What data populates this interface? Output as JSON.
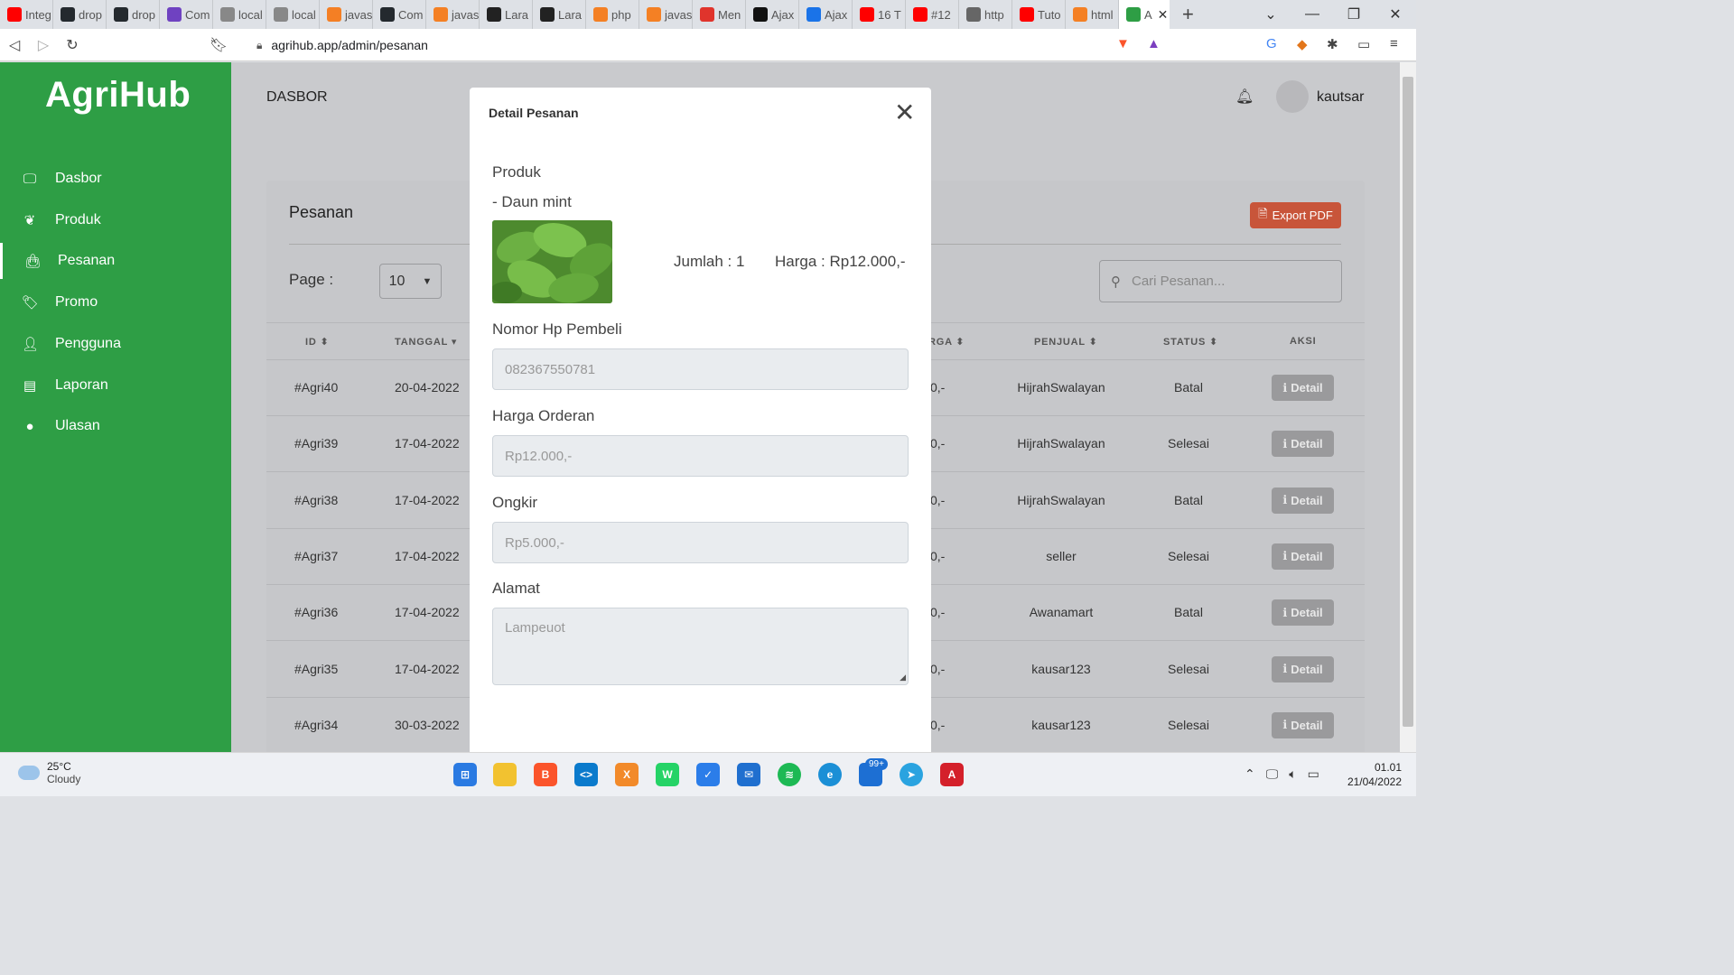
{
  "browser": {
    "tabs": [
      {
        "label": "Integ",
        "icon": "youtube-icon",
        "color": "#ff0000"
      },
      {
        "label": "drop",
        "icon": "github-icon",
        "color": "#24292e"
      },
      {
        "label": "drop",
        "icon": "github-icon",
        "color": "#24292e"
      },
      {
        "label": "Com",
        "icon": "app-icon",
        "color": "#6f42c1"
      },
      {
        "label": "local",
        "icon": "leaf-icon",
        "color": "#888888"
      },
      {
        "label": "local",
        "icon": "chart-icon",
        "color": "#888888"
      },
      {
        "label": "javas",
        "icon": "code-icon",
        "color": "#f47f24"
      },
      {
        "label": "Com",
        "icon": "github-icon",
        "color": "#24292e"
      },
      {
        "label": "javas",
        "icon": "stackoverflow-icon",
        "color": "#f48024"
      },
      {
        "label": "Lara",
        "icon": "tm-icon",
        "color": "#222222"
      },
      {
        "label": "Lara",
        "icon": "tm-icon",
        "color": "#222222"
      },
      {
        "label": "php",
        "icon": "stackoverflow-icon",
        "color": "#f48024"
      },
      {
        "label": "javas",
        "icon": "stackoverflow-icon",
        "color": "#f48024"
      },
      {
        "label": "Men",
        "icon": "qa-icon",
        "color": "#e0342c"
      },
      {
        "label": "Ajax",
        "icon": "circle-icon",
        "color": "#111111"
      },
      {
        "label": "Ajax",
        "icon": "st-icon",
        "color": "#1a73e8"
      },
      {
        "label": "16 T",
        "icon": "youtube-icon",
        "color": "#ff0000"
      },
      {
        "label": "#12",
        "icon": "youtube-icon",
        "color": "#ff0000"
      },
      {
        "label": "http",
        "icon": "page-icon",
        "color": "#666666"
      },
      {
        "label": "Tuto",
        "icon": "youtube-icon",
        "color": "#ff0000"
      },
      {
        "label": "html",
        "icon": "stackoverflow-icon",
        "color": "#f48024"
      },
      {
        "label": "A",
        "icon": "leaf-icon",
        "color": "#2e9e45"
      }
    ],
    "url": "agrihub.app/admin/pesanan"
  },
  "sidebar": {
    "logo": "AgriHub",
    "items": [
      {
        "label": "Dasbor",
        "icon": "monitor-icon"
      },
      {
        "label": "Produk",
        "icon": "leaf-icon"
      },
      {
        "label": "Pesanan",
        "icon": "shopping-bag-icon"
      },
      {
        "label": "Promo",
        "icon": "tag-icon"
      },
      {
        "label": "Pengguna",
        "icon": "user-icon"
      },
      {
        "label": "Laporan",
        "icon": "report-icon"
      },
      {
        "label": "Ulasan",
        "icon": "chat-icon"
      }
    ]
  },
  "header": {
    "title": "DASBOR",
    "username": "kautsar"
  },
  "orders": {
    "title": "Pesanan",
    "export_label": "Export PDF",
    "page_label": "Page :",
    "page_size": "10",
    "search_placeholder": "Cari Pesanan...",
    "columns": [
      "ID",
      "TANGGAL",
      "RGA",
      "PENJUAL",
      "STATUS",
      "AKSI"
    ],
    "detail_label": "Detail",
    "rows": [
      {
        "id": "#Agri40",
        "date": "20-04-2022",
        "price_frag": "0,-",
        "seller": "HijrahSwalayan",
        "status": "Batal"
      },
      {
        "id": "#Agri39",
        "date": "17-04-2022",
        "price_frag": "0,-",
        "seller": "HijrahSwalayan",
        "status": "Selesai"
      },
      {
        "id": "#Agri38",
        "date": "17-04-2022",
        "price_frag": "0,-",
        "seller": "HijrahSwalayan",
        "status": "Batal"
      },
      {
        "id": "#Agri37",
        "date": "17-04-2022",
        "price_frag": "0,-",
        "seller": "seller",
        "status": "Selesai"
      },
      {
        "id": "#Agri36",
        "date": "17-04-2022",
        "price_frag": "0,-",
        "seller": "Awanamart",
        "status": "Batal"
      },
      {
        "id": "#Agri35",
        "date": "17-04-2022",
        "price_frag": "0,-",
        "seller": "kausar123",
        "status": "Selesai"
      },
      {
        "id": "#Agri34",
        "date": "30-03-2022",
        "price_frag": "0,-",
        "seller": "kausar123",
        "status": "Selesai"
      }
    ]
  },
  "modal": {
    "title": "Detail Pesanan",
    "produk_label": "Produk",
    "product_name": "- Daun mint",
    "jumlah": "Jumlah : 1",
    "harga": "Harga : Rp12.000,-",
    "phone_label": "Nomor Hp Pembeli",
    "phone_value": "082367550781",
    "order_price_label": "Harga Orderan",
    "order_price_value": "Rp12.000,-",
    "shipping_label": "Ongkir",
    "shipping_value": "Rp5.000,-",
    "address_label": "Alamat",
    "address_value": "Lampeuot"
  },
  "taskbar": {
    "temperature": "25°C",
    "weather": "Cloudy",
    "badge": "99+",
    "time": "01.01",
    "date": "21/04/2022"
  }
}
